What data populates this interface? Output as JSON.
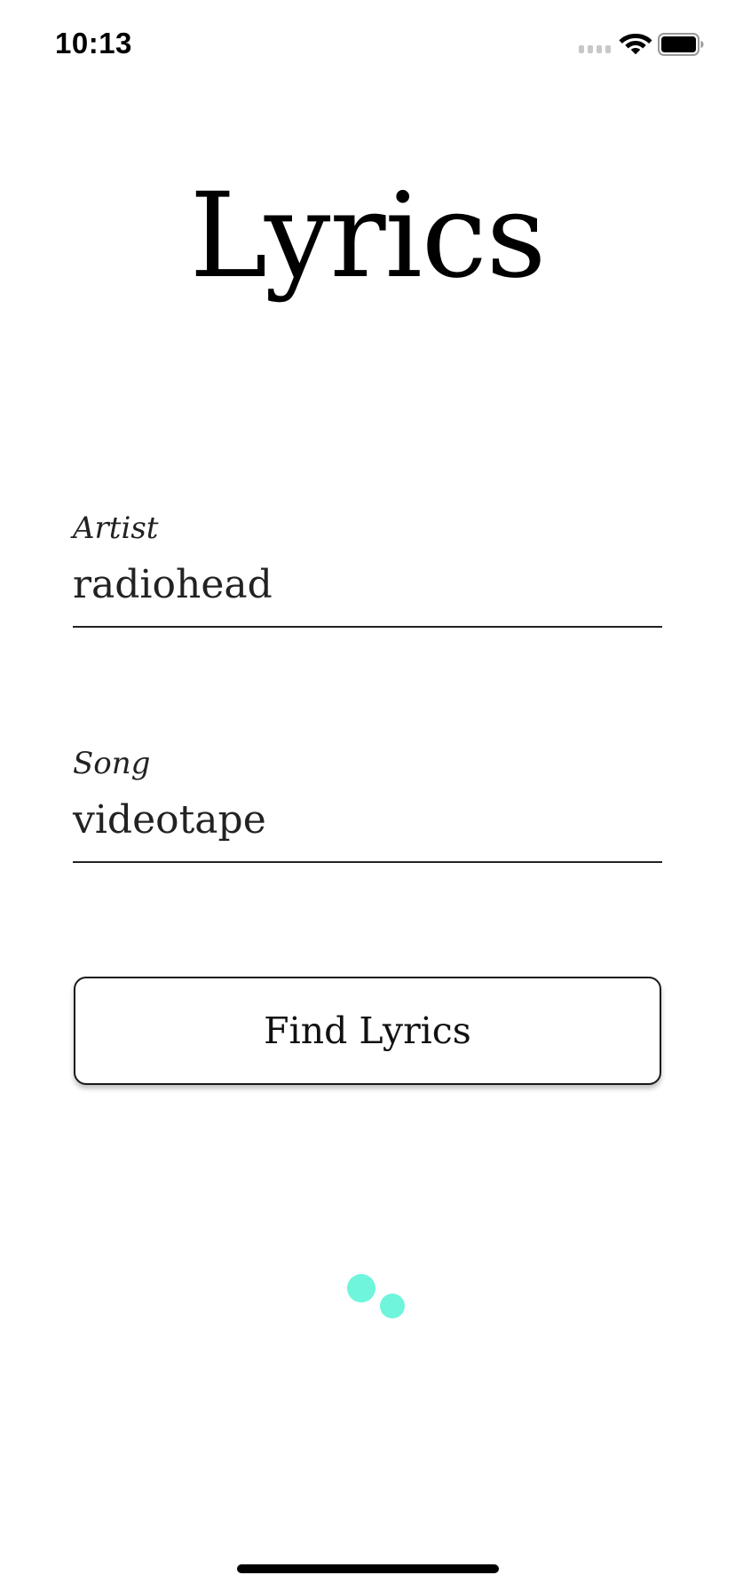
{
  "status_bar": {
    "time": "10:13",
    "icons": [
      "signal-icon",
      "wifi-icon",
      "battery-icon"
    ]
  },
  "title": "Lyrics",
  "artist": {
    "label": "Artist",
    "value": "radiohead"
  },
  "song": {
    "label": "Song",
    "value": "videotape"
  },
  "find_button": {
    "label": "Find Lyrics"
  },
  "colors": {
    "loader": "#6ff5dc",
    "text": "#111111",
    "background": "#ffffff"
  }
}
